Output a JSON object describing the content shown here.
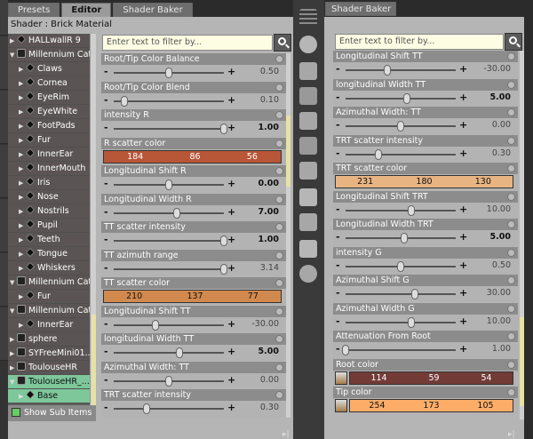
{
  "tabs": {
    "presets": "Presets",
    "editor": "Editor",
    "shader_baker_left": "Shader Baker",
    "shader_baker_right": "Shader Baker"
  },
  "shader_title": "Shader : Brick Material",
  "filter_placeholder": "Enter text to filter by...",
  "show_sub_items": "Show Sub Items",
  "tree": [
    {
      "label": "HALLwallR 9",
      "type": "mat",
      "depth": 0,
      "expand": "▶"
    },
    {
      "label": "Millennium Cat...",
      "type": "fig",
      "depth": 0,
      "expand": "▼"
    },
    {
      "label": "Claws",
      "type": "mat",
      "depth": 1,
      "expand": "▶"
    },
    {
      "label": "Cornea",
      "type": "mat",
      "depth": 1,
      "expand": "▶"
    },
    {
      "label": "EyeRim",
      "type": "mat",
      "depth": 1,
      "expand": "▶"
    },
    {
      "label": "EyeWhite",
      "type": "mat",
      "depth": 1,
      "expand": "▶"
    },
    {
      "label": "FootPads",
      "type": "mat",
      "depth": 1,
      "expand": "▶"
    },
    {
      "label": "Fur",
      "type": "mat",
      "depth": 1,
      "expand": "▶"
    },
    {
      "label": "InnerEar",
      "type": "mat",
      "depth": 1,
      "expand": "▶"
    },
    {
      "label": "InnerMouth",
      "type": "mat",
      "depth": 1,
      "expand": "▶"
    },
    {
      "label": "Iris",
      "type": "mat",
      "depth": 1,
      "expand": "▶"
    },
    {
      "label": "Nose",
      "type": "mat",
      "depth": 1,
      "expand": "▶"
    },
    {
      "label": "Nostrils",
      "type": "mat",
      "depth": 1,
      "expand": "▶"
    },
    {
      "label": "Pupil",
      "type": "mat",
      "depth": 1,
      "expand": "▶"
    },
    {
      "label": "Teeth",
      "type": "mat",
      "depth": 1,
      "expand": "▶"
    },
    {
      "label": "Tongue",
      "type": "mat",
      "depth": 1,
      "expand": "▶"
    },
    {
      "label": "Whiskers",
      "type": "mat",
      "depth": 1,
      "expand": "▶"
    },
    {
      "label": "Millennium Cat...",
      "type": "fig",
      "depth": 0,
      "expand": "▼"
    },
    {
      "label": "Fur",
      "type": "mat",
      "depth": 1,
      "expand": "▶"
    },
    {
      "label": "Millennium Cat...",
      "type": "fig",
      "depth": 0,
      "expand": "▼"
    },
    {
      "label": "InnerEar",
      "type": "mat",
      "depth": 1,
      "expand": "▶"
    },
    {
      "label": "sphere",
      "type": "fig",
      "depth": 0,
      "expand": "▶"
    },
    {
      "label": "SYFreeMini01...",
      "type": "fig",
      "depth": 0,
      "expand": "▶"
    },
    {
      "label": "ToulouseHR",
      "type": "fig",
      "depth": 0,
      "expand": "▶"
    },
    {
      "label": "ToulouseHR_...",
      "type": "fig",
      "depth": 0,
      "expand": "▼",
      "selected": true
    },
    {
      "label": "Base",
      "type": "mat",
      "depth": 1,
      "expand": "▶",
      "selected": true
    }
  ],
  "left_props": [
    {
      "label": "Root/Tip Color Balance",
      "kind": "slider",
      "value": "0.50",
      "pos": 0.5,
      "bold": false
    },
    {
      "label": "Root/Tip Color Blend",
      "kind": "slider",
      "value": "0.10",
      "pos": 0.1,
      "bold": false
    },
    {
      "label": "intensity R",
      "kind": "slider",
      "value": "1.00",
      "pos": 1.0,
      "bold": true
    },
    {
      "label": "R scatter color",
      "kind": "color",
      "rgb": [
        "184",
        "86",
        "56"
      ],
      "hex": "#b85638"
    },
    {
      "label": "Longitudinal Shift R",
      "kind": "slider",
      "value": "0.00",
      "pos": 0.5,
      "bold": true
    },
    {
      "label": "Longitudinal Width R",
      "kind": "slider",
      "value": "7.00",
      "pos": 0.57,
      "bold": true
    },
    {
      "label": "TT scatter intensity",
      "kind": "slider",
      "value": "1.00",
      "pos": 1.0,
      "bold": true
    },
    {
      "label": "TT azimuth range",
      "kind": "slider",
      "value": "3.14",
      "pos": 1.0,
      "bold": false
    },
    {
      "label": "TT scatter color",
      "kind": "color",
      "rgb": [
        "210",
        "137",
        "77"
      ],
      "hex": "#d2894d"
    },
    {
      "label": "Longitudinal Shift TT",
      "kind": "slider",
      "value": "-30.00",
      "pos": 0.38,
      "bold": false
    },
    {
      "label": "longitudinal Width TT",
      "kind": "slider",
      "value": "5.00",
      "pos": 0.6,
      "bold": true
    },
    {
      "label": "Azimuthal Width: TT",
      "kind": "slider",
      "value": "0.00",
      "pos": 0.5,
      "bold": false
    },
    {
      "label": "TRT scatter intensity",
      "kind": "slider",
      "value": "0.30",
      "pos": 0.3,
      "bold": false
    }
  ],
  "right_props": [
    {
      "label": "Longitudinal Shift TT",
      "kind": "slider",
      "value": "-30.00",
      "pos": 0.38,
      "bold": false
    },
    {
      "label": "longitudinal Width TT",
      "kind": "slider",
      "value": "5.00",
      "pos": 0.56,
      "bold": true
    },
    {
      "label": "Azimuthal Width: TT",
      "kind": "slider",
      "value": "0.00",
      "pos": 0.5,
      "bold": false
    },
    {
      "label": "TRT scatter intensity",
      "kind": "slider",
      "value": "0.30",
      "pos": 0.3,
      "bold": false
    },
    {
      "label": "TRT scatter color",
      "kind": "color",
      "rgb": [
        "231",
        "180",
        "130"
      ],
      "hex": "#e7b482"
    },
    {
      "label": "Longitudinal Shift TRT",
      "kind": "slider",
      "value": "10.00",
      "pos": 0.6,
      "bold": false
    },
    {
      "label": "Longitudinal Width TRT",
      "kind": "slider",
      "value": "5.00",
      "pos": 0.53,
      "bold": true
    },
    {
      "label": "intensity G",
      "kind": "slider",
      "value": "0.50",
      "pos": 0.5,
      "bold": false
    },
    {
      "label": "Azimuthal Shift G",
      "kind": "slider",
      "value": "30.00",
      "pos": 0.63,
      "bold": false
    },
    {
      "label": "Azimuthal Width G",
      "kind": "slider",
      "value": "10.00",
      "pos": 0.6,
      "bold": false
    },
    {
      "label": "Attenuation From Root",
      "kind": "slider",
      "value": "1.00",
      "pos": 0.0,
      "bold": false
    },
    {
      "label": "Root color",
      "kind": "color",
      "rgb": [
        "114",
        "59",
        "54"
      ],
      "hex": "#723b36",
      "swatch": true
    },
    {
      "label": "Tip color",
      "kind": "color",
      "rgb": [
        "254",
        "173",
        "105"
      ],
      "hex": "#fead69",
      "swatch": true
    }
  ],
  "icons": [
    "menu-icon",
    "surface-icon",
    "shape-icon",
    "node-icon",
    "brush-icon",
    "paint-icon",
    "bone-icon",
    "joint-icon",
    "figure-icon",
    "figure-pose-icon",
    "globe-icon"
  ],
  "colors": {
    "selected_row": "#7dc79a",
    "filter_bg": "#fdfde4",
    "panel_bg": "#b5b5b5",
    "prop_header": "#8c8c8c"
  }
}
